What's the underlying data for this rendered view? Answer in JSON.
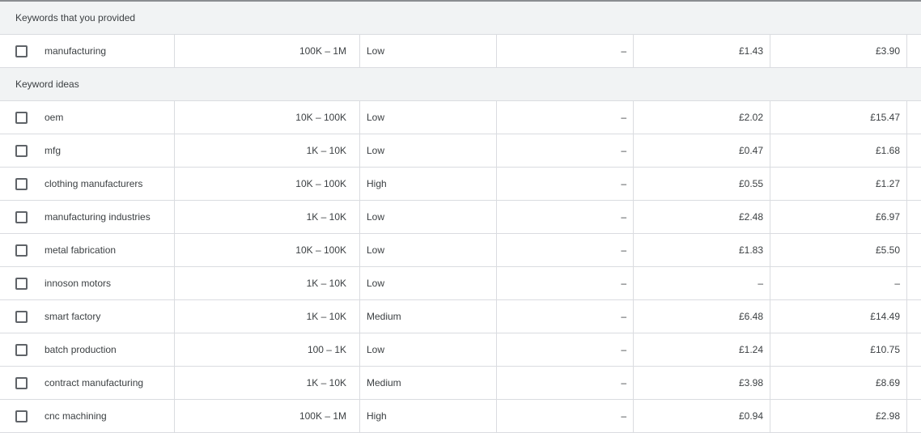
{
  "sections": [
    {
      "title": "Keywords that you provided",
      "rows": [
        {
          "keyword": "manufacturing",
          "avg_monthly_searches": "100K – 1M",
          "competition": "Low",
          "ad_impression_share": "–",
          "top_of_page_bid_low": "£1.43",
          "top_of_page_bid_high": "£3.90",
          "checked": false
        }
      ]
    },
    {
      "title": "Keyword ideas",
      "rows": [
        {
          "keyword": "oem",
          "avg_monthly_searches": "10K – 100K",
          "competition": "Low",
          "ad_impression_share": "–",
          "top_of_page_bid_low": "£2.02",
          "top_of_page_bid_high": "£15.47",
          "checked": false
        },
        {
          "keyword": "mfg",
          "avg_monthly_searches": "1K – 10K",
          "competition": "Low",
          "ad_impression_share": "–",
          "top_of_page_bid_low": "£0.47",
          "top_of_page_bid_high": "£1.68",
          "checked": false
        },
        {
          "keyword": "clothing manufacturers",
          "avg_monthly_searches": "10K – 100K",
          "competition": "High",
          "ad_impression_share": "–",
          "top_of_page_bid_low": "£0.55",
          "top_of_page_bid_high": "£1.27",
          "checked": false
        },
        {
          "keyword": "manufacturing industries",
          "avg_monthly_searches": "1K – 10K",
          "competition": "Low",
          "ad_impression_share": "–",
          "top_of_page_bid_low": "£2.48",
          "top_of_page_bid_high": "£6.97",
          "checked": false
        },
        {
          "keyword": "metal fabrication",
          "avg_monthly_searches": "10K – 100K",
          "competition": "Low",
          "ad_impression_share": "–",
          "top_of_page_bid_low": "£1.83",
          "top_of_page_bid_high": "£5.50",
          "checked": false
        },
        {
          "keyword": "innoson motors",
          "avg_monthly_searches": "1K – 10K",
          "competition": "Low",
          "ad_impression_share": "–",
          "top_of_page_bid_low": "–",
          "top_of_page_bid_high": "–",
          "checked": false
        },
        {
          "keyword": "smart factory",
          "avg_monthly_searches": "1K – 10K",
          "competition": "Medium",
          "ad_impression_share": "–",
          "top_of_page_bid_low": "£6.48",
          "top_of_page_bid_high": "£14.49",
          "checked": false
        },
        {
          "keyword": "batch production",
          "avg_monthly_searches": "100 – 1K",
          "competition": "Low",
          "ad_impression_share": "–",
          "top_of_page_bid_low": "£1.24",
          "top_of_page_bid_high": "£10.75",
          "checked": false
        },
        {
          "keyword": "contract manufacturing",
          "avg_monthly_searches": "1K – 10K",
          "competition": "Medium",
          "ad_impression_share": "–",
          "top_of_page_bid_low": "£3.98",
          "top_of_page_bid_high": "£8.69",
          "checked": false
        },
        {
          "keyword": "cnc machining",
          "avg_monthly_searches": "100K – 1M",
          "competition": "High",
          "ad_impression_share": "–",
          "top_of_page_bid_low": "£0.94",
          "top_of_page_bid_high": "£2.98",
          "checked": false
        }
      ]
    }
  ],
  "icons": {
    "checkbox": "checkbox-unchecked-icon"
  }
}
